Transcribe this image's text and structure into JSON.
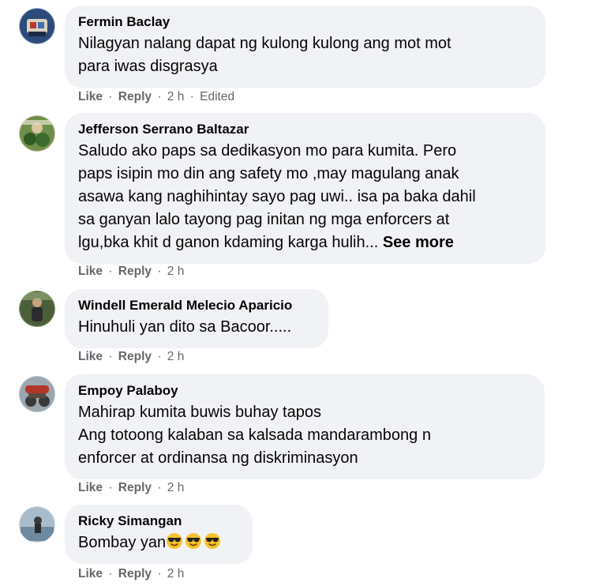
{
  "comments": [
    {
      "author": "Fermin Baclay",
      "lines": [
        "Nilagyan nalang dapat ng kulong kulong ang mot mot",
        "para iwas disgrasya"
      ],
      "like_label": "Like",
      "reply_label": "Reply",
      "time": "2 h",
      "edited": "Edited",
      "avatar_color": "#2c4a7a"
    },
    {
      "author": "Jefferson Serrano Baltazar",
      "lines": [
        "Saludo ako paps sa dedikasyon mo para kumita. Pero",
        "paps isipin mo din ang safety mo ,may magulang anak",
        "asawa kang naghihintay sayo pag uwi.. isa pa baka dahil",
        "sa ganyan lalo tayong pag initan ng mga enforcers at",
        "lgu,bka khit d ganon kdaming karga hulih..."
      ],
      "see_more": "See more",
      "like_label": "Like",
      "reply_label": "Reply",
      "time": "2 h",
      "avatar_color": "#3d6b2e"
    },
    {
      "author": "Windell Emerald Melecio Aparicio",
      "lines": [
        "Hinuhuli yan dito sa Bacoor....."
      ],
      "like_label": "Like",
      "reply_label": "Reply",
      "time": "2 h",
      "avatar_color": "#4b5e3a"
    },
    {
      "author": "Empoy Palaboy",
      "lines": [
        "Mahirap kumita buwis buhay tapos",
        "Ang totoong kalaban sa kalsada mandarambong n",
        "enforcer at ordinansa ng diskriminasyon"
      ],
      "like_label": "Like",
      "reply_label": "Reply",
      "time": "2 h",
      "avatar_color": "#8a4b3c"
    },
    {
      "author": "Ricky Simangan",
      "lines": [
        "Bombay yan"
      ],
      "emoji_count": 3,
      "emoji_name": "smiling-face-with-sunglasses",
      "like_label": "Like",
      "reply_label": "Reply",
      "time": "2 h",
      "avatar_color": "#6f8aa0"
    }
  ],
  "colors": {
    "bubble": "#f0f2f5",
    "text": "#050505",
    "meta": "#65676b"
  }
}
